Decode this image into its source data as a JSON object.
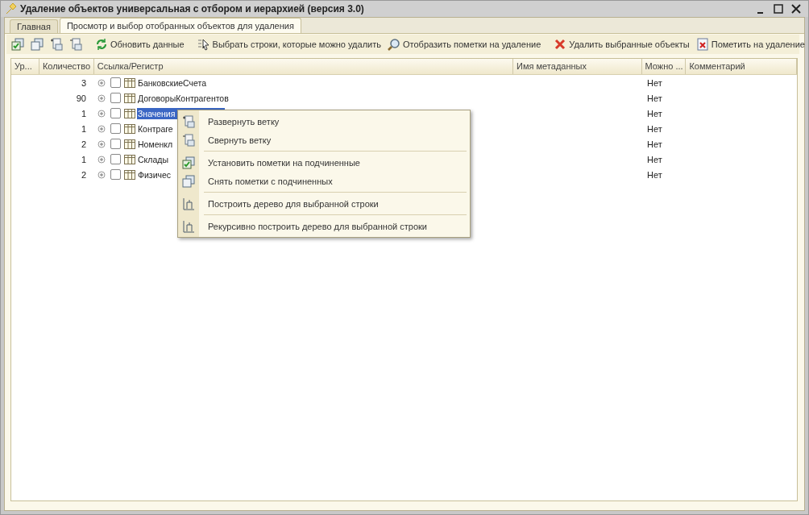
{
  "window": {
    "title": "Удаление объектов универсальная с отбором и иерархией (версия 3.0)"
  },
  "tabs": [
    {
      "label": "Главная",
      "selected": false
    },
    {
      "label": "Просмотр и выбор отобранных объектов для удаления",
      "selected": true
    }
  ],
  "toolbar": {
    "groups": [
      [
        {
          "kind": "check-all"
        },
        {
          "kind": "uncheck-all"
        },
        {
          "kind": "expand"
        },
        {
          "kind": "collapse"
        }
      ],
      [
        {
          "kind": "refresh",
          "label": "Обновить данные"
        }
      ],
      [
        {
          "kind": "select",
          "label": "Выбрать строки, которые можно удалить"
        },
        {
          "kind": "find",
          "label": "Отобразить пометки на удаление"
        }
      ],
      [
        {
          "kind": "delete",
          "label": "Удалить выбранные объекты"
        },
        {
          "kind": "mark",
          "label": "Пометить на удаление"
        }
      ]
    ]
  },
  "table": {
    "columns": [
      "Ур...",
      "Количество",
      "Ссылка/Регистр",
      "Имя метаданных",
      "Можно ...",
      "Комментарий"
    ],
    "rows": [
      {
        "count": "3",
        "ref": "БанковскиеСчета",
        "can_delete": "Нет",
        "checked": false,
        "selected": false
      },
      {
        "count": "90",
        "ref": "ДоговорыКонтрагентов",
        "can_delete": "Нет",
        "checked": false,
        "selected": false
      },
      {
        "count": "1",
        "ref": "Значения",
        "can_delete": "Нет",
        "checked": false,
        "selected": true
      },
      {
        "count": "1",
        "ref": "Контраге",
        "can_delete": "Нет",
        "checked": false,
        "selected": false
      },
      {
        "count": "2",
        "ref": "Номенкл",
        "can_delete": "Нет",
        "checked": false,
        "selected": false
      },
      {
        "count": "1",
        "ref": "Склады",
        "can_delete": "Нет",
        "checked": false,
        "selected": false
      },
      {
        "count": "2",
        "ref": "Физичес",
        "can_delete": "Нет",
        "checked": false,
        "selected": false
      }
    ]
  },
  "context_menu": {
    "items": [
      {
        "kind": "expand",
        "label": "Развернуть ветку"
      },
      {
        "kind": "collapse",
        "label": "Свернуть ветку"
      },
      {
        "kind": "separator"
      },
      {
        "kind": "check-all",
        "label": "Установить пометки на подчиненные"
      },
      {
        "kind": "uncheck-all",
        "label": "Снять пометки с подчиненных"
      },
      {
        "kind": "separator"
      },
      {
        "kind": "tree",
        "label": "Построить дерево для выбранной строки"
      },
      {
        "kind": "separator"
      },
      {
        "kind": "tree",
        "label": "Рекурсивно построить дерево для выбранной строки"
      }
    ]
  }
}
